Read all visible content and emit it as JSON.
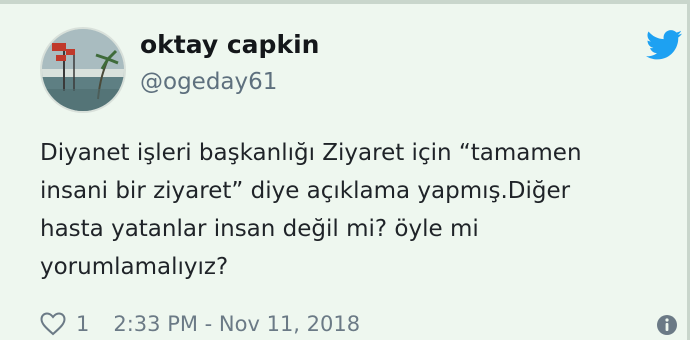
{
  "tweet": {
    "author_name": "oktay capkin",
    "author_handle": "@ogeday61",
    "text_lines": [
      "Diyanet işleri başkanlığı Ziyaret için “tamamen",
      "insani bir ziyaret” diye açıklama yapmış.Diğer",
      "hasta yatanlar insan değil mi? öyle mi",
      "yorumlamalıyız?"
    ],
    "like_count": "1",
    "timestamp": "2:33 PM - Nov 11, 2018"
  },
  "icons": {
    "brand": "twitter-bird-icon",
    "like": "heart-icon",
    "info": "info-icon"
  },
  "colors": {
    "background": "#eef7ef",
    "twitter_blue": "#1da1f2",
    "muted_text": "#6b7a86"
  }
}
